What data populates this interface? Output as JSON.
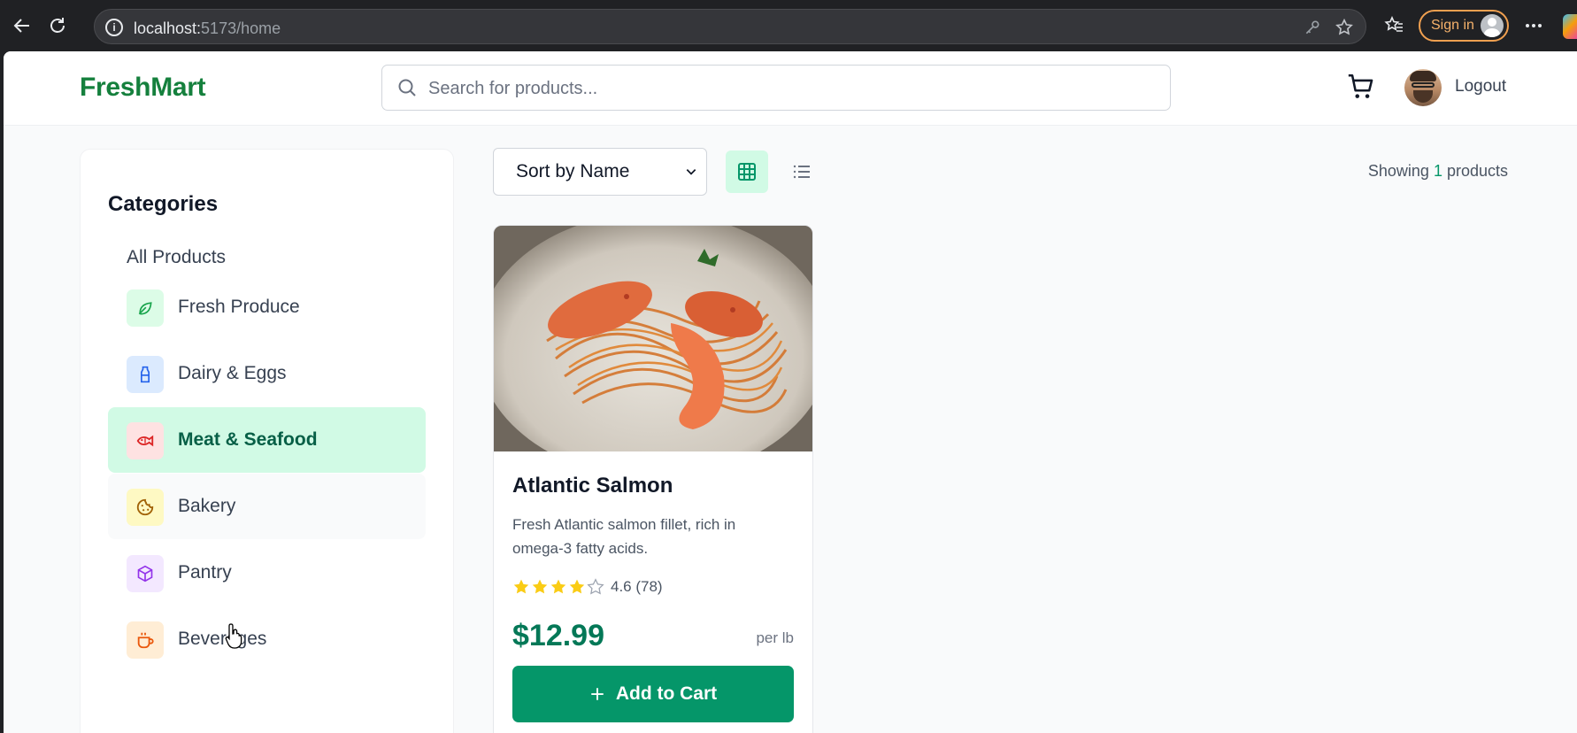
{
  "browser": {
    "url_host": "localhost:",
    "url_rest": "5173/home",
    "sign_in_label": "Sign in"
  },
  "header": {
    "logo": "FreshMart",
    "search_placeholder": "Search for products...",
    "logout_label": "Logout"
  },
  "sidebar": {
    "title": "Categories",
    "all_label": "All Products",
    "items": [
      {
        "label": "Fresh Produce",
        "icon": "leaf-icon",
        "bg": "#dcfce7",
        "color": "#16a34a"
      },
      {
        "label": "Dairy & Eggs",
        "icon": "milk-bottle-icon",
        "bg": "#dbeafe",
        "color": "#2563eb"
      },
      {
        "label": "Meat & Seafood",
        "icon": "fish-icon",
        "bg": "#fee2e2",
        "color": "#dc2626",
        "active": true
      },
      {
        "label": "Bakery",
        "icon": "cookie-icon",
        "bg": "#fef9c3",
        "color": "#ca8a04"
      },
      {
        "label": "Pantry",
        "icon": "box-icon",
        "bg": "#f3e8ff",
        "color": "#9333ea"
      },
      {
        "label": "Beverages",
        "icon": "coffee-icon",
        "bg": "#ffedd5",
        "color": "#ea580c"
      }
    ]
  },
  "toolbar": {
    "sort_options": [
      "Sort by Name"
    ],
    "sort_selected": "Sort by Name",
    "showing_prefix": "Showing ",
    "showing_count": "1",
    "showing_suffix": " products"
  },
  "products": [
    {
      "name": "Atlantic Salmon",
      "description": "Fresh Atlantic salmon fillet, rich in omega-3 fatty acids.",
      "rating": 4.6,
      "rating_text": "4.6 (78)",
      "price": "$12.99",
      "unit": "per lb",
      "button_label": "Add to Cart"
    }
  ],
  "colors": {
    "brand": "#15803d",
    "accent": "#059669",
    "active_bg": "#d1fae5",
    "star": "#facc15"
  }
}
